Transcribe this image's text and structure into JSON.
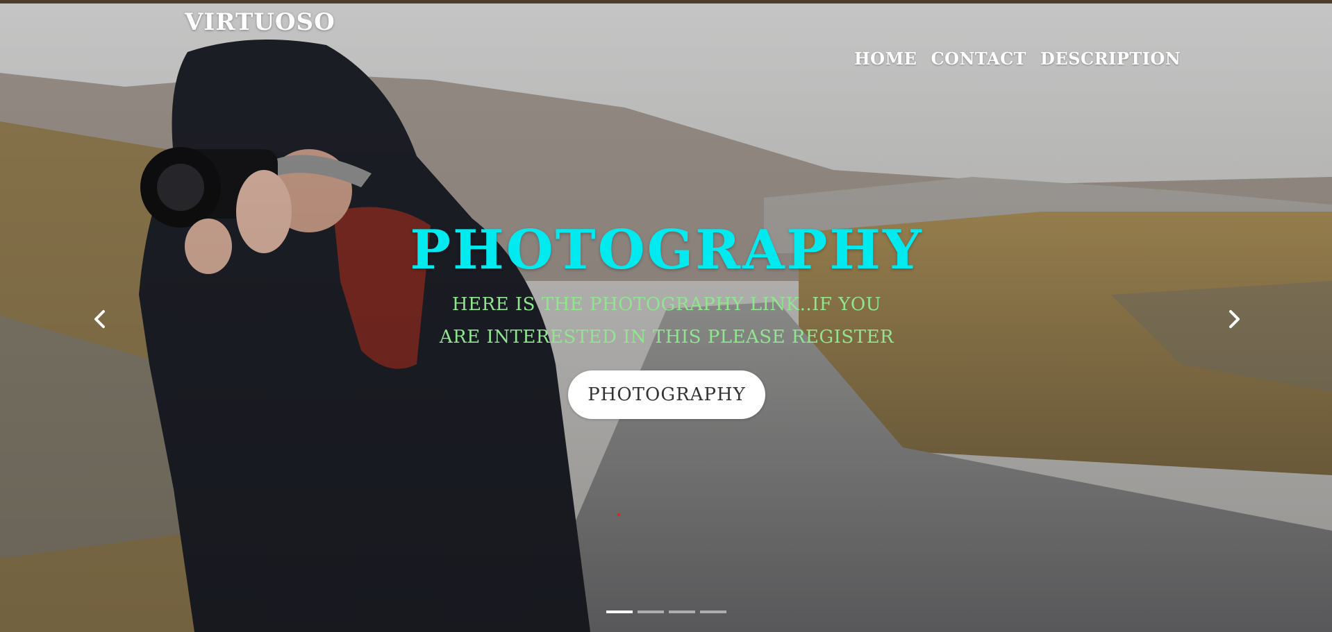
{
  "header": {
    "brand": "VIRTUOSO",
    "nav": [
      {
        "label": "HOME"
      },
      {
        "label": "CONTACT"
      },
      {
        "label": "DESCRIPTION"
      }
    ]
  },
  "slide": {
    "title": "PHOTOGRAPHY",
    "subtitle": "HERE IS THE PHOTOGRAPHY LINK..IF YOU ARE INTERESTED IN THIS PLEASE REGISTER",
    "button_label": "PHOTOGRAPHY",
    "background_image": "photographer-with-camera-on-mountain-road"
  },
  "carousel": {
    "prev_icon": "chevron-left-icon",
    "next_icon": "chevron-right-icon",
    "indicator_count": 4,
    "active_index": 0
  },
  "colors": {
    "title": "#00eaf0",
    "subtitle": "#8fe68f",
    "button_bg": "#ffffff",
    "button_text": "#333333",
    "top_strip": "#4a3f2f"
  }
}
